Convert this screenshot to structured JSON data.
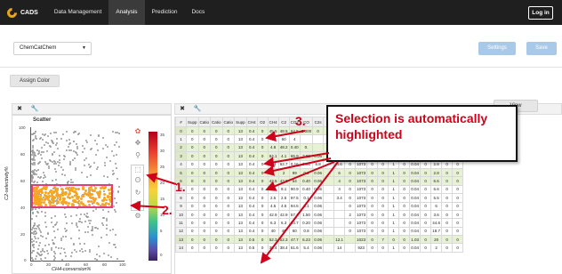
{
  "nav": {
    "brand": "CADS",
    "items": [
      "Data Management",
      "Analysis",
      "Prediction",
      "Docs"
    ],
    "active_index": 1,
    "login": "Log in"
  },
  "toolbar": {
    "dataset": "ChemCatChem",
    "settings": "Settings",
    "save": "Save",
    "assign_color": "Assign Color",
    "view": "View"
  },
  "scatter": {
    "title": "Scatter",
    "xlabel": "CH4-conversion%",
    "ylabel": "C2-selectivity%",
    "xticks": [
      "0",
      "20",
      "40",
      "60",
      "80",
      "100"
    ],
    "yticks": [
      "100",
      "80",
      "60",
      "40",
      "20",
      "0"
    ],
    "colorbar_ticks": [
      "35",
      "30",
      "25",
      "20",
      "15",
      "10",
      "5",
      "0"
    ]
  },
  "table": {
    "headers": [
      "#",
      "Supp",
      "Catio",
      "Catio",
      "Catio",
      "Supp",
      "CH4",
      "O2",
      "CH4",
      "C2",
      "CO2",
      "CO",
      "C2s"
    ],
    "rows": [
      {
        "n": "0",
        "hl": true,
        "cells": [
          "0",
          "0",
          "0",
          "0",
          "13",
          "0.4",
          "0",
          "45.5",
          "48.5",
          "64.5",
          "5.000",
          "0"
        ]
      },
      {
        "n": "1",
        "hl": false,
        "cells": [
          "0",
          "0",
          "0",
          "0",
          "13",
          "0.4",
          "0",
          "40",
          "60",
          "4",
          "",
          ""
        ]
      },
      {
        "n": "2",
        "hl": true,
        "cells": [
          "0",
          "0",
          "0",
          "0",
          "13",
          "0.4",
          "0",
          "4.8",
          "48.2",
          "0.40",
          "0.",
          ""
        ]
      },
      {
        "n": "3",
        "hl": true,
        "cells": [
          "0",
          "0",
          "0",
          "0",
          "13",
          "0.4",
          "0",
          "84.1",
          "4.1",
          "65.9",
          "2.99",
          "0.06"
        ]
      },
      {
        "n": "4",
        "hl": false,
        "cells": [
          "0",
          "0",
          "0",
          "0",
          "13",
          "0.4",
          "0",
          "1.3",
          "62.7",
          "0.16",
          "0.06",
          "6.8"
        ]
      },
      {
        "n": "5",
        "hl": true,
        "cells": [
          "0",
          "0",
          "0",
          "0",
          "13",
          "0.4",
          "0",
          "2",
          "2",
          "99",
          "0.1",
          "0.06"
        ]
      },
      {
        "n": "6",
        "hl": true,
        "cells": [
          "0",
          "0",
          "0",
          "0",
          "13",
          "0.4",
          "0",
          "43.5",
          "43.5",
          "54",
          "0.40",
          "0.06"
        ]
      },
      {
        "n": "7",
        "hl": false,
        "cells": [
          "0",
          "0",
          "0",
          "0",
          "13",
          "0.4",
          "0",
          "8.1",
          "8.1",
          "90.9",
          "0.40",
          "0.06"
        ]
      },
      {
        "n": "8",
        "hl": false,
        "cells": [
          "0",
          "0",
          "0",
          "0",
          "13",
          "0.4",
          "0",
          "2.5",
          "2.5",
          "97.5",
          "0.1",
          "0.06"
        ]
      },
      {
        "n": "9",
        "hl": false,
        "cells": [
          "0",
          "0",
          "0",
          "0",
          "13",
          "0.4",
          "0",
          "4.5",
          "4.5",
          "94.5",
          "0.1",
          "0.06"
        ]
      },
      {
        "n": "10",
        "hl": false,
        "cells": [
          "0",
          "0",
          "0",
          "0",
          "13",
          "0.4",
          "0",
          "42.9",
          "42.9",
          "57.1",
          "1.50",
          "0.06"
        ]
      },
      {
        "n": "11",
        "hl": false,
        "cells": [
          "0",
          "0",
          "0",
          "0",
          "13",
          "0.4",
          "0",
          "6.3",
          "6.3",
          "93.7",
          "0.20",
          "0.06"
        ]
      },
      {
        "n": "12",
        "hl": false,
        "cells": [
          "0",
          "0",
          "0",
          "0",
          "13",
          "0.4",
          "0",
          "40",
          "40",
          "60",
          "0.8",
          "0.06"
        ]
      },
      {
        "n": "13",
        "hl": true,
        "cells": [
          "0",
          "0",
          "0",
          "0",
          "13",
          "0.5",
          "0",
          "52.3",
          "52.3",
          "47.7",
          "6.23",
          "0.06"
        ]
      },
      {
        "n": "14",
        "hl": false,
        "cells": [
          "0",
          "0",
          "0",
          "0",
          "13",
          "0.5",
          "0",
          "38.4",
          "38.4",
          "61.6",
          "5.4",
          "0.06"
        ]
      }
    ],
    "right_cols": [
      [
        "",
        "",
        "",
        "",
        "",
        "",
        "",
        "",
        "",
        "",
        "",
        "",
        "",
        "",
        ""
      ],
      [
        "",
        "",
        "",
        "2",
        "4.6",
        "6",
        "4",
        "4",
        "3.4",
        "",
        "",
        "",
        "",
        "12.1",
        "14"
      ],
      [
        "",
        "",
        "",
        "0",
        "0",
        "0",
        "0",
        "0",
        "0",
        "0",
        "2",
        "0",
        "0",
        "",
        ""
      ],
      [
        "",
        "",
        "",
        "1073",
        "1073",
        "1073",
        "1073",
        "1073",
        "1073",
        "1073",
        "1073",
        "1073",
        "1073",
        "1023",
        "923"
      ],
      [
        "",
        "",
        "",
        "0",
        "0",
        "0",
        "0",
        "0",
        "0",
        "0",
        "0",
        "0",
        "0",
        "0",
        "0"
      ],
      [
        "",
        "",
        "",
        "0",
        "0",
        "0",
        "0",
        "0",
        "0",
        "0",
        "0",
        "0",
        "0",
        "7",
        "0"
      ],
      [
        "",
        "",
        "",
        "1",
        "1",
        "1",
        "1",
        "1",
        "1",
        "1",
        "1",
        "1",
        "1",
        "0",
        "1"
      ],
      [
        "",
        "",
        "",
        "0",
        "0",
        "0",
        "0",
        "0",
        "0",
        "0",
        "0",
        "0",
        "0",
        "0",
        "0"
      ],
      [
        "",
        "",
        "",
        "0.04",
        "0.04",
        "0.04",
        "0.04",
        "0.04",
        "0.04",
        "0.04",
        "0.04",
        "0.04",
        "0.04",
        "1.03",
        "0.04"
      ],
      [
        "",
        "",
        "",
        "0",
        "0",
        "0",
        "0",
        "0",
        "0",
        "0",
        "0",
        "0",
        "0",
        "0",
        "0"
      ],
      [
        "",
        "",
        "",
        "10.4",
        "2.8",
        "2.8",
        "6.6",
        "6.6",
        "5.5",
        "6",
        "3.6",
        "44.6",
        "18.7",
        "20",
        "2"
      ],
      [
        "",
        "",
        "",
        "0",
        "0",
        "0",
        "0",
        "0",
        "0",
        "0",
        "0",
        "0",
        "0",
        "0",
        "0"
      ],
      [
        "",
        "",
        "",
        "0",
        "0",
        "0",
        "0",
        "0",
        "0",
        "0",
        "0",
        "0",
        "0",
        "0",
        "0"
      ]
    ]
  },
  "annotations": {
    "callout": "Selection is automatically highlighted",
    "label1": "1.",
    "label2": "2.",
    "label3": "3."
  },
  "colors": {
    "selection_rect": "#e0407a",
    "selected_points": "#f5a623",
    "highlight_row": "#e7f1d3",
    "annotation": "#d0021b"
  }
}
